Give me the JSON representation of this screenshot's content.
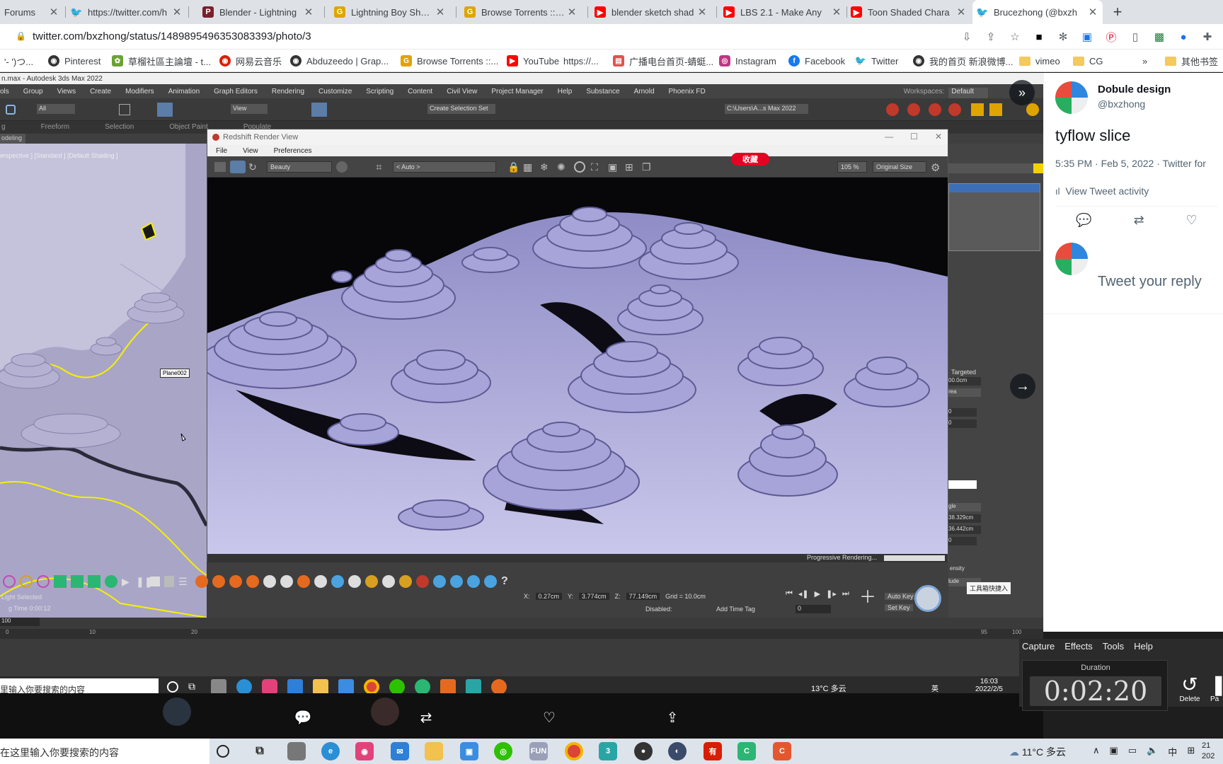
{
  "tabs": [
    {
      "title": "Forums",
      "favicon": "forum-icon",
      "color": "#5f6368"
    },
    {
      "title": "https://twitter.com/h",
      "favicon": "twitter-icon",
      "color": "#1d9bf0"
    },
    {
      "title": "Blender - Lightning",
      "favicon": "patreon-icon",
      "color": "#7a1f2b"
    },
    {
      "title": "Lightning Boy Shade",
      "favicon": "gumroad-icon",
      "color": "#e0a400"
    },
    {
      "title": "Browse Torrents :: CG",
      "favicon": "gumroad-icon",
      "color": "#e0a400"
    },
    {
      "title": "blender sketch shad",
      "favicon": "youtube-icon",
      "color": "#ff0000"
    },
    {
      "title": "LBS 2.1 - Make Any",
      "favicon": "youtube-icon",
      "color": "#ff0000"
    },
    {
      "title": "Toon Shaded Chara",
      "favicon": "youtube-icon",
      "color": "#ff0000"
    },
    {
      "title": "Brucezhong (@bxzh",
      "favicon": "twitter-icon",
      "color": "#1d9bf0"
    }
  ],
  "address": {
    "url": "twitter.com/bxzhong/status/1489895496353083393/photo/3"
  },
  "bookmarks": [
    {
      "label": "'- ')つ...",
      "icon": "none"
    },
    {
      "label": "Pinterest",
      "icon": "globe-icon",
      "color": "#333"
    },
    {
      "label": "草榴社區主論壇 - t...",
      "icon": "leaf-icon",
      "color": "#6aa332"
    },
    {
      "label": "网易云音乐",
      "icon": "netease-icon",
      "color": "#d81e06"
    },
    {
      "label": "Abduzeedo | Grap...",
      "icon": "globe-icon",
      "color": "#333"
    },
    {
      "label": "Browse Torrents ::...",
      "icon": "gumroad-icon",
      "color": "#e0a400"
    },
    {
      "label": "YouTube",
      "icon": "youtube-icon",
      "color": "#ff0000"
    },
    {
      "label": "https://...",
      "icon": "none"
    },
    {
      "label": "广播电台首页-蜻蜓...",
      "icon": "radio-icon",
      "color": "#e0524f"
    },
    {
      "label": "Instagram",
      "icon": "instagram-icon",
      "color": "#c13584"
    },
    {
      "label": "Facebook",
      "icon": "facebook-icon",
      "color": "#1877f2"
    },
    {
      "label": "Twitter",
      "icon": "twitter-icon",
      "color": "#1d9bf0"
    },
    {
      "label": "我的首页 新浪微博...",
      "icon": "globe-icon",
      "color": "#333"
    },
    {
      "label": "vimeo",
      "icon": "folder-icon"
    },
    {
      "label": "CG",
      "icon": "folder-icon"
    },
    {
      "label": "»",
      "icon": "none"
    },
    {
      "label": "其他书签",
      "icon": "folder-icon"
    }
  ],
  "max": {
    "title": "n.max - Autodesk 3ds Max 2022",
    "menu": [
      "ols",
      "Group",
      "Views",
      "Create",
      "Modifiers",
      "Animation",
      "Graph Editors",
      "Rendering",
      "Customize",
      "Scripting",
      "Content",
      "Civil View",
      "Project Manager",
      "Help",
      "Substance",
      "Arnold",
      "Phoenix FD"
    ],
    "workspace_label": "Workspaces:",
    "workspace_value": "Default",
    "selection_set": "Create Selection Set",
    "view_dropdown": "View",
    "all_dropdown": "All",
    "path": "C:\\Users\\A...s Max 2022",
    "ribbon": [
      "g",
      "Freeform",
      "Selection",
      "Object Paint",
      "Populate"
    ],
    "modeling_tab": "odeling",
    "viewport_label": "erspective ] [Standard ] [Default Shading ]",
    "plane_label": "Plane002",
    "frame": "100",
    "timeline_ticks": [
      "0",
      "10",
      "20",
      "95",
      "100"
    ],
    "light_selected": "Light Selected",
    "render_time": "g Time  0:00:12",
    "coord_x": "0.27cm",
    "coord_y": "3.774cm",
    "coord_z": "77.149cm",
    "grid": "Grid = 10.0cm",
    "add_time_tag": "Add Time Tag",
    "auto_key": "Auto Key",
    "set_key": "Set Key",
    "disabled": "Disabled:",
    "frame_field": "0",
    "cmd_targeted": "Targeted",
    "cmd_values": [
      "00.0cm",
      "rea",
      "0",
      "0",
      "gle",
      "38.329cm",
      "36.442cm",
      "0",
      "ensity",
      "lude"
    ]
  },
  "redshift": {
    "title": "Redshift Render View",
    "menu": [
      "File",
      "View",
      "Preferences"
    ],
    "aov": "Beauty",
    "camera": "< Auto >",
    "zoom": "105 %",
    "size": "Original Size",
    "status": "Progressive Rendering..."
  },
  "inner_taskbar": {
    "search": "里输入你要搜索的内容",
    "weather": "13°C 多云",
    "time": "16:03",
    "date": "2022/2/5",
    "ime": "英",
    "tooltip": "工具箱快捷入"
  },
  "photo_overlay": {
    "pin_button": "收藏"
  },
  "tweet": {
    "name": "Dobule design",
    "handle": "@bxzhong",
    "text": "tyflow slice",
    "meta": "5:35 PM · Feb 5, 2022 · Twitter for",
    "activity": "View Tweet activity",
    "reply_placeholder": "Tweet your reply"
  },
  "capture": {
    "menu": [
      "Capture",
      "Effects",
      "Tools",
      "Help"
    ],
    "duration_label": "Duration",
    "duration": "0:02:20",
    "delete": "Delete",
    "pause": "Pa"
  },
  "taskbar": {
    "search": "在这里输入你要搜索的内容",
    "weather": "11°C 多云",
    "ime": "中",
    "time": "21",
    "date": "202"
  }
}
